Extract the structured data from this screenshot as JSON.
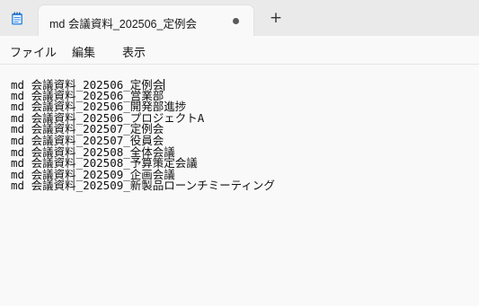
{
  "tab": {
    "title": "md 会議資料_202506_定例会",
    "new_tab_label": "+"
  },
  "menu": {
    "file": "ファイル",
    "edit": "編集",
    "view": "表示"
  },
  "editor": {
    "lines": [
      "md 会議資料_202506_定例会",
      "md 会議資料_202506_営業部",
      "md 会議資料_202506_開発部進捗",
      "md 会議資料_202506_プロジェクトA",
      "md 会議資料_202507_定例会",
      "md 会議資料_202507_役員会",
      "md 会議資料_202508_全体会議",
      "md 会議資料_202508_予算策定会議",
      "md 会議資料_202509_企画会議",
      "md 会議資料_202509_新製品ローンチミーティング"
    ]
  },
  "colors": {
    "tabstrip_bg": "#eaeaea",
    "editor_bg": "#f9f9f9",
    "notepad_icon": "#3a8ee6"
  },
  "icons": {
    "app": "notepad-icon",
    "unsaved": "unsaved-dot-icon",
    "new_tab": "plus-icon"
  }
}
